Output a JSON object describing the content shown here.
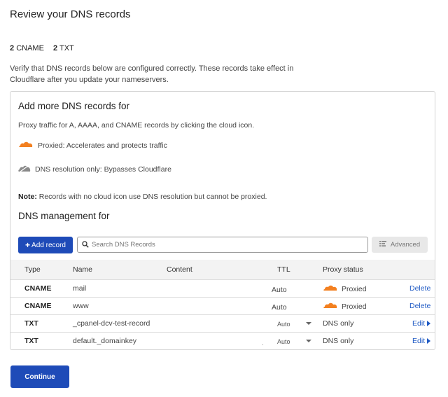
{
  "page": {
    "title": "Review your DNS records",
    "counts": [
      {
        "number": "2",
        "label": "CNAME"
      },
      {
        "number": "2",
        "label": "TXT"
      }
    ],
    "intro": "Verify that DNS records below are configured correctly. These records take effect in Cloudflare after you update your nameservers."
  },
  "panel": {
    "title": "Add more DNS records for",
    "hint": "Proxy traffic for A, AAAA, and CNAME records by clicking the cloud icon.",
    "legend_proxied": "Proxied: Accelerates and protects traffic",
    "legend_dns_only": "DNS resolution only: Bypasses Cloudflare",
    "note_label": "Note:",
    "note_text": " Records with no cloud icon use DNS resolution but cannot be proxied.",
    "mgmt_title": "DNS management for"
  },
  "toolbar": {
    "add_label": "Add record",
    "search_placeholder": "Search DNS Records",
    "advanced_label": "Advanced"
  },
  "table": {
    "headers": {
      "type": "Type",
      "name": "Name",
      "content": "Content",
      "ttl": "TTL",
      "proxy": "Proxy status"
    },
    "rows": [
      {
        "type": "CNAME",
        "name": "mail",
        "ttl": "Auto",
        "proxy": "Proxied",
        "action": "Delete"
      },
      {
        "type": "CNAME",
        "name": "www",
        "ttl": "Auto",
        "proxy": "Proxied",
        "action": "Delete"
      },
      {
        "type": "TXT",
        "name": "_cpanel-dcv-test-record",
        "ttl": "Auto",
        "proxy": "DNS only",
        "action": "Edit"
      },
      {
        "type": "TXT",
        "name": "default._domainkey",
        "content_dot": ".",
        "ttl": "Auto",
        "proxy": "DNS only",
        "action": "Edit"
      }
    ]
  },
  "footer": {
    "continue_label": "Continue"
  },
  "colors": {
    "accent": "#1e4bb8",
    "link": "#1f5ac4",
    "proxied_cloud": "#f38020",
    "dns_cloud": "#8a8a8a"
  },
  "icons": {
    "proxied": "orange-cloud-icon",
    "dns_only": "gray-cloud-icon",
    "search": "search-icon",
    "advanced": "filter-lines-icon",
    "plus": "plus-icon"
  }
}
